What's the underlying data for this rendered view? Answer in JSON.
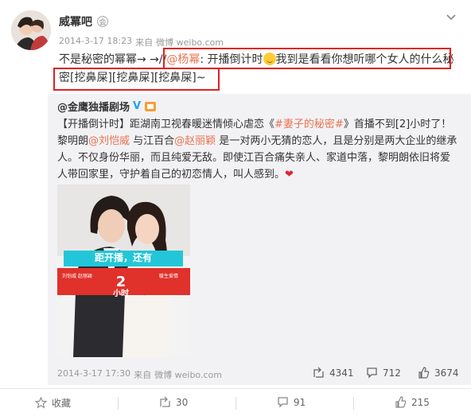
{
  "post": {
    "author": "威冪吧",
    "badge": "会",
    "time": "2014-3-17 18:23",
    "via_prefix": "来自",
    "source": "微博 weibo.com",
    "text_part1": "不是秘密的幂幂→ →//",
    "mention": "@杨幂",
    "text_part2": ": 开播倒计时",
    "text_part3": "我到是看看你想听哪个女人的什么秘密[挖鼻屎][挖鼻屎][挖鼻屎]~"
  },
  "repost": {
    "author": "@金鹰独播剧场",
    "v_badge": "V",
    "text_a": "【开播倒计时】距湖南卫视春暖迷情倾心虐恋《",
    "topic": "#妻子的秘密#",
    "text_b": "》首播不到[2]小时了！黎明朗",
    "mention1": "@刘恺威",
    "text_c": " 与江百合",
    "mention2": "@赵丽颖",
    "text_d": " 是一对两小无猜的恋人，且是分别是两大企业的继承人。不仅身份华丽，而且纯爱无敌。即使江百合痛失亲人、家道中落，黎明朗依旧将爱人带回家里，守护着自己的初恋情人，叫人感到。",
    "heart": "❤",
    "time": "2014-3-17 17:30",
    "via_prefix": "来自",
    "source": "微博 weibo.com",
    "reposts": "4341",
    "comments": "712",
    "likes": "3674",
    "poster": {
      "banner_text": "距开播，还有",
      "countdown_number": "2",
      "countdown_unit": "小时",
      "actor_left": "刘恺威 赵丽颖",
      "tagline_right": "暖生爱情"
    }
  },
  "actions": {
    "favorite": "收藏",
    "repost": "30",
    "comment": "91",
    "like": "215"
  },
  "colors": {
    "link": "#eb7350",
    "highlight_box": "#e02020",
    "repost_bg": "#f2f2f5",
    "verified_blue": "#1fa3f0"
  }
}
